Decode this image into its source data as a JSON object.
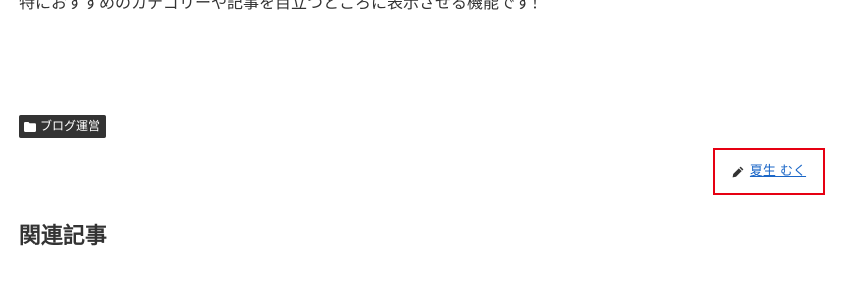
{
  "article": {
    "intro_text": "特におすすめのカテゴリーや記事を目立つところに表示させる機能です！"
  },
  "category": {
    "label": "ブログ運営",
    "icon": "folder-icon"
  },
  "author": {
    "name": "夏生 むく",
    "icon": "pencil-icon",
    "highlight_color": "#e60012"
  },
  "related": {
    "heading": "関連記事"
  }
}
